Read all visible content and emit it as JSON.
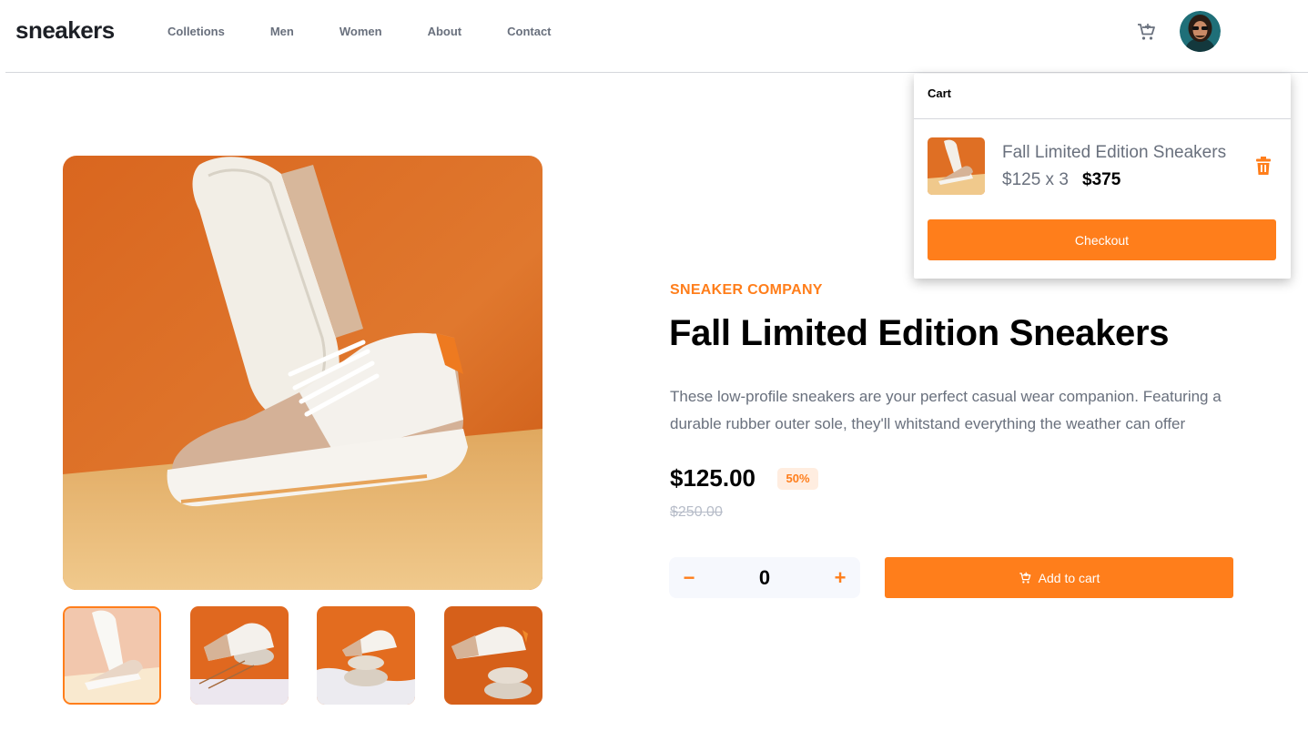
{
  "header": {
    "logo": "sneakers",
    "nav": [
      "Colletions",
      "Men",
      "Women",
      "About",
      "Contact"
    ]
  },
  "gallery": {
    "main_alt": "product-image",
    "thumbnails": [
      "thumbnail-1",
      "thumbnail-2",
      "thumbnail-3",
      "thumbnail-4"
    ],
    "active_thumbnail": 0
  },
  "product": {
    "company": "SNEAKER COMPANY",
    "title": "Fall Limited Edition Sneakers",
    "description": "These low-profile sneakers are your perfect casual wear companion. Featuring a durable rubber outer sole, they'll whitstand everything the weather can offer",
    "price": "$125.00",
    "discount": "50%",
    "old_price": "$250.00",
    "quantity": "0",
    "minus_label": "−",
    "plus_label": "+",
    "add_to_cart_label": "Add to cart"
  },
  "cart": {
    "heading": "Cart",
    "item_name": "Fall Limited Edition Sneakers",
    "item_price": "$125 x 3",
    "item_total": "$375",
    "checkout_label": "Checkout"
  },
  "colors": {
    "accent": "#ff7e1b",
    "accent_pale": "#ffede0",
    "text_dark": "#1d2026",
    "text_grey": "#69707d",
    "old_price": "#b6bcc8",
    "qty_bg": "#f6f8fd"
  },
  "icons": {
    "cart": "cart-icon",
    "delete": "trash-icon",
    "avatar": "user-avatar"
  }
}
